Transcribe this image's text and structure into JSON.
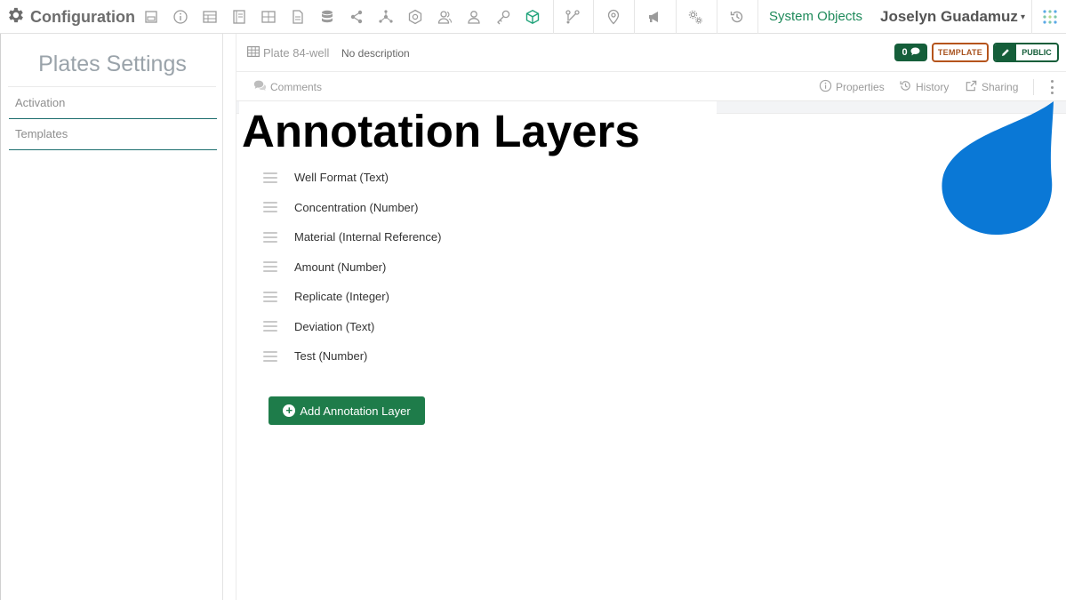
{
  "nav": {
    "brand": "Configuration",
    "system_objects": "System Objects",
    "user_name": "Joselyn Guadamuz"
  },
  "sidebar": {
    "title": "Plates Settings",
    "items": [
      {
        "label": "Activation"
      },
      {
        "label": "Templates"
      }
    ]
  },
  "object": {
    "name": "Plate 84-well",
    "description": "No description",
    "comment_count": "0",
    "template_badge": "TEMPLATE",
    "public_badge": "PUBLIC"
  },
  "toolbar": {
    "comments": "Comments",
    "properties": "Properties",
    "history": "History",
    "sharing": "Sharing"
  },
  "main": {
    "heading": "Annotation Layers",
    "layers": [
      {
        "label": "Well Format (Text)"
      },
      {
        "label": "Concentration (Number)"
      },
      {
        "label": "Material (Internal Reference)"
      },
      {
        "label": "Amount (Number)"
      },
      {
        "label": "Replicate (Integer)"
      },
      {
        "label": "Deviation (Text)"
      },
      {
        "label": "Test (Number)"
      }
    ],
    "add_button": "Add Annotation Layer"
  },
  "colors": {
    "accent_green": "#1e7c4a",
    "badge_dark_green": "#155e3a",
    "template_orange": "#b5541c",
    "drop_blue": "#0a78d6"
  }
}
